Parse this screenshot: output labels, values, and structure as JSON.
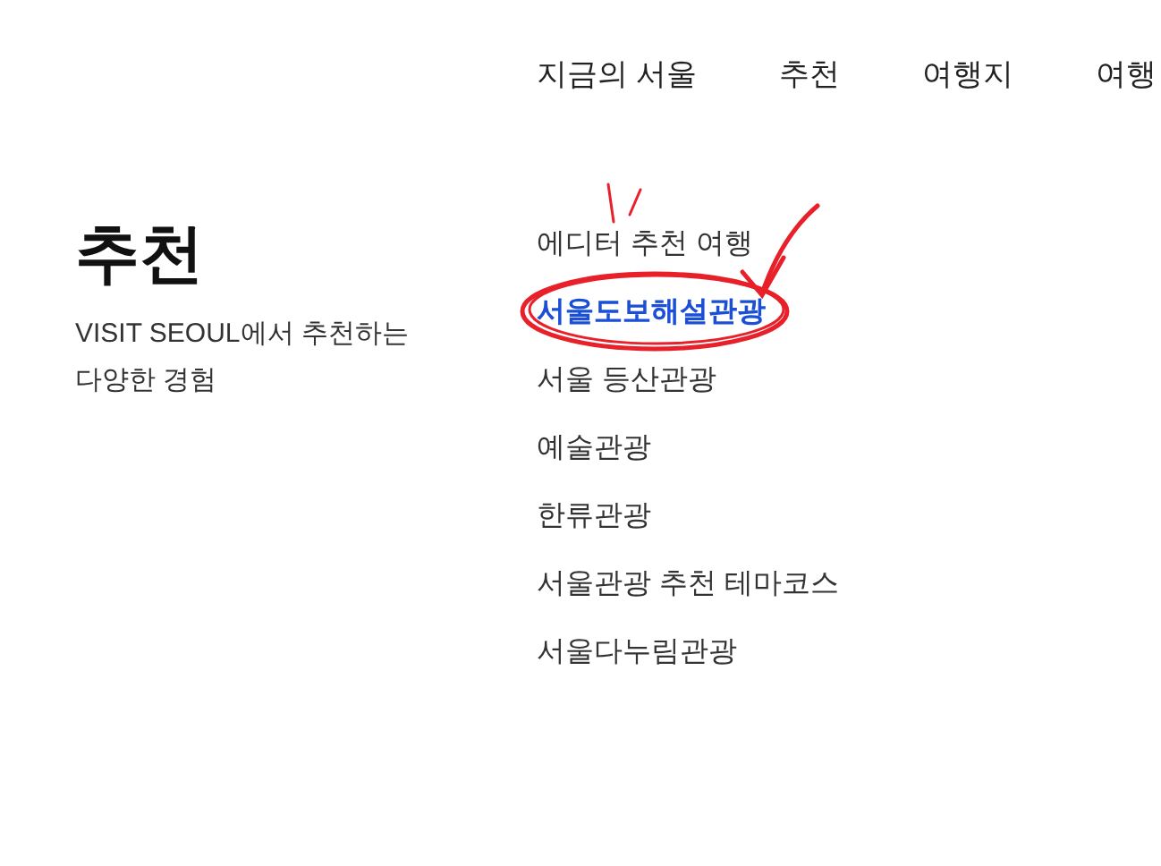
{
  "nav": [
    {
      "label": "지금의 서울",
      "selected": false
    },
    {
      "label": "추천",
      "selected": false
    },
    {
      "label": "여행지",
      "selected": false
    },
    {
      "label": "여행",
      "selected": false
    }
  ],
  "section": {
    "title": "추천",
    "description": "VISIT SEOUL에서 추천하는 다양한 경험"
  },
  "menu": [
    {
      "label": "에디터 추천 여행",
      "selected": false
    },
    {
      "label": "서울도보해설관광",
      "selected": true
    },
    {
      "label": "서울 등산관광",
      "selected": false
    },
    {
      "label": "예술관광",
      "selected": false
    },
    {
      "label": "한류관광",
      "selected": false
    },
    {
      "label": "서울관광 추천 테마코스",
      "selected": false
    },
    {
      "label": "서울다누림관광",
      "selected": false
    }
  ]
}
